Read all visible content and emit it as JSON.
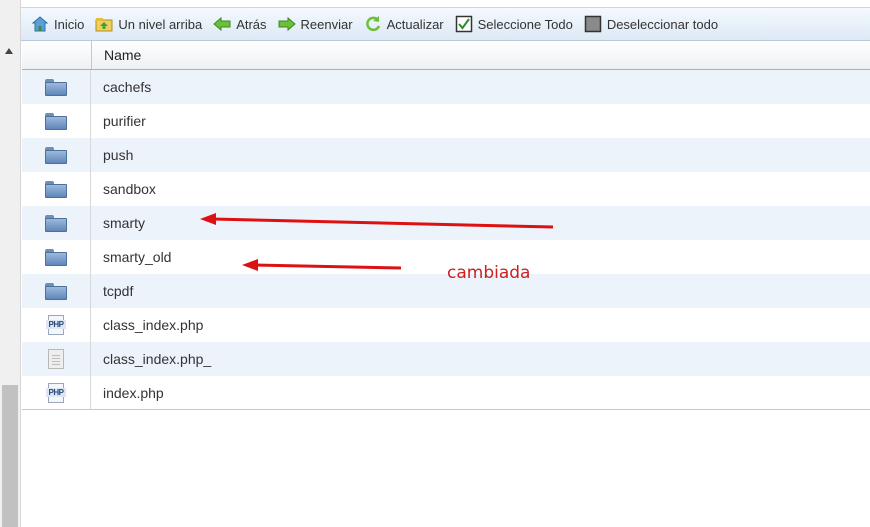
{
  "toolbar": {
    "buttons": [
      {
        "label": "Inicio",
        "icon": "home-icon"
      },
      {
        "label": "Un nivel arriba",
        "icon": "folder-up-icon"
      },
      {
        "label": "Atrás",
        "icon": "arrow-left-icon"
      },
      {
        "label": "Reenviar",
        "icon": "arrow-right-icon"
      },
      {
        "label": "Actualizar",
        "icon": "refresh-icon"
      },
      {
        "label": "Seleccione Todo",
        "icon": "checkbox-checked-icon"
      },
      {
        "label": "Deseleccionar todo",
        "icon": "checkbox-empty-icon"
      }
    ]
  },
  "table": {
    "header": {
      "name": "Name"
    },
    "rows": [
      {
        "name": "cachefs",
        "type": "folder"
      },
      {
        "name": "purifier",
        "type": "folder"
      },
      {
        "name": "push",
        "type": "folder"
      },
      {
        "name": "sandbox",
        "type": "folder"
      },
      {
        "name": "smarty",
        "type": "folder"
      },
      {
        "name": "smarty_old",
        "type": "folder"
      },
      {
        "name": "tcpdf",
        "type": "folder"
      },
      {
        "name": "class_index.php",
        "type": "php"
      },
      {
        "name": "class_index.php_",
        "type": "file"
      },
      {
        "name": "index.php",
        "type": "php"
      }
    ]
  },
  "annotation": {
    "text": "cambiada",
    "color": "#cc1f1f"
  },
  "icons": {
    "php_label": "PHP"
  }
}
